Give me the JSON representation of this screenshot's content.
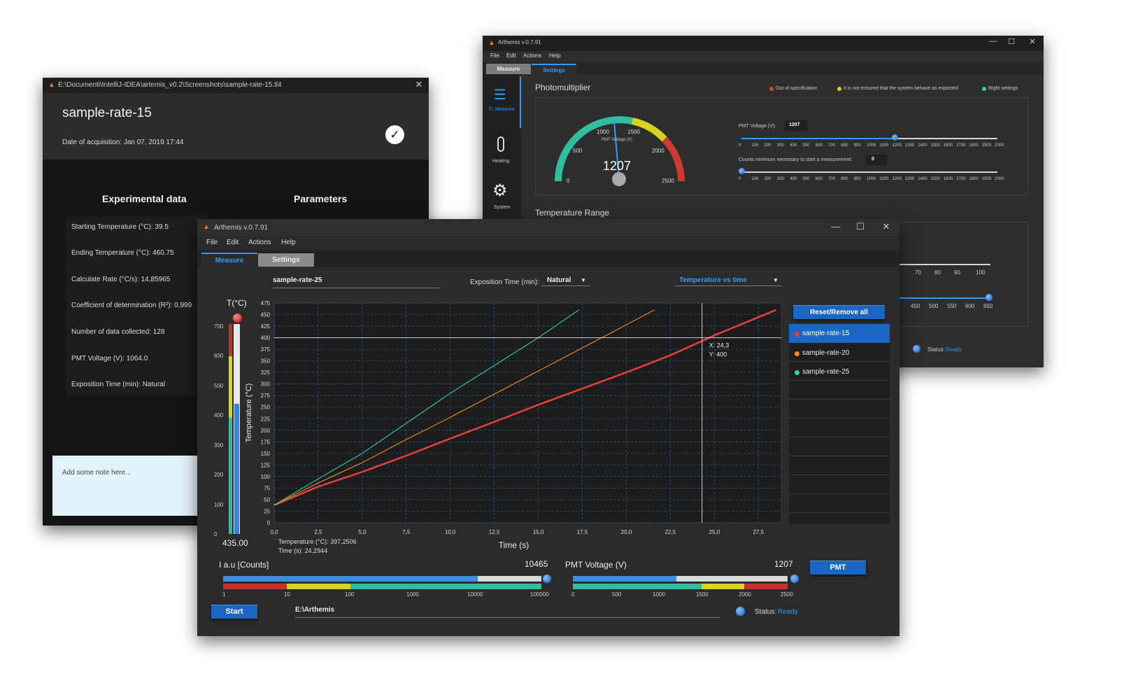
{
  "detail_window": {
    "path": "E:\\Documenti\\IntelliJ-IDEA\\artemis_v0.2\\Screenshots\\sample-rate-15.tl4",
    "sample_name": "sample-rate-15",
    "acquisition": "Date of acquisition:  Jan 07, 2019 17:44",
    "section_experimental": "Experimental data",
    "section_parameters": "Parameters",
    "rows": [
      "Starting Temperature (°C):  39.5",
      "Ending Temperature (°C):  460.75",
      "Calculate Rate (°C/s):   14,85965",
      "Coefficient of determination (R²):  0,999",
      "Number of  data collected:  128",
      "PMT Voltage (V):  1064.0",
      "Exposition Time (min):  Natural"
    ],
    "note_placeholder": "Add some note here..."
  },
  "settings_window": {
    "title": "Arthemis v.0.7.91",
    "menu": [
      "File",
      "Edit",
      "Actions",
      "Help"
    ],
    "tabs": [
      "Measure",
      "Settings"
    ],
    "side_nav": [
      "TL Measure",
      "Heating",
      "System"
    ],
    "photomultiplier_title": "Photomultiplier",
    "legend": [
      "Out of specification",
      "It is not ensured that the system behave as expected",
      "Right settings"
    ],
    "gauge": {
      "label": "PMT Voltage (V)",
      "value": "1207",
      "ticks": [
        "0",
        "500",
        "1000",
        "1500",
        "2000",
        "2500"
      ]
    },
    "pmt_voltage_label": "PMT Voltage (V):",
    "pmt_voltage_value": "1207",
    "counts_label": "Counts minimum necessary to start a measurement:",
    "counts_value": "0",
    "slider_ticks": [
      "0",
      "100",
      "200",
      "300",
      "400",
      "500",
      "600",
      "700",
      "800",
      "900",
      "1000",
      "1100",
      "1200",
      "1300",
      "1400",
      "1500",
      "1600",
      "1700",
      "1800",
      "1900",
      "2000"
    ],
    "temperature_range_title": "Temperature Range",
    "range_ticks_a": [
      "70",
      "80",
      "90",
      "100"
    ],
    "range_ticks_b": [
      "450",
      "500",
      "550",
      "600",
      "650"
    ],
    "status_label": "Status:",
    "status_value": "Ready"
  },
  "main_window": {
    "title": "Arthemis v.0.7.91",
    "menu": [
      "File",
      "Edit",
      "Actions",
      "Help"
    ],
    "tabs": [
      "Measure",
      "Settings"
    ],
    "sample_name": "sample-rate-25",
    "exposition_label": "Exposition Time (min):",
    "exposition_value": "Natural",
    "chart_select": "Temperature vs time",
    "thermo_title": "T(°C)",
    "thermo_value": "435.00",
    "thermo_ticks": [
      "700",
      "600",
      "500",
      "400",
      "300",
      "200",
      "100",
      "0"
    ],
    "thermo_level": 0.62,
    "cursor_readout": [
      "Temperature (°C): 397,2506",
      "Time (s): 24,2944"
    ],
    "crosshair_label": [
      "X: 24,3",
      "Y: 400"
    ],
    "reset_button": "Reset/Remove all",
    "samples": [
      {
        "name": "sample-rate-15",
        "color": "#e8403a"
      },
      {
        "name": "sample-rate-20",
        "color": "#f0901e"
      },
      {
        "name": "sample-rate-25",
        "color": "#2fd1a8"
      }
    ],
    "counts_label": "I a.u [Counts]",
    "counts_value": "10465",
    "counts_ticks": [
      "1",
      "10",
      "100",
      "1000",
      "10000",
      "100000"
    ],
    "pmt_label": "PMT Voltage (V)",
    "pmt_value": "1207",
    "pmt_ticks": [
      "0",
      "500",
      "1000",
      "1500",
      "2000",
      "2500"
    ],
    "pmt_button": "PMT",
    "start_button": "Start",
    "path": "E:\\Arthemis",
    "status_label": "Status:",
    "status_value": "Ready"
  },
  "chart_data": {
    "type": "line",
    "xlabel": "Time (s)",
    "ylabel": "Temperature (°C)",
    "xlim": [
      0,
      28.8
    ],
    "ylim": [
      0,
      475
    ],
    "xticks": [
      "0,0",
      "2,5",
      "5,0",
      "7,5",
      "10,0",
      "12,5",
      "15,0",
      "17,5",
      "20,0",
      "22,5",
      "25,0",
      "27,5"
    ],
    "yticks": [
      "0",
      "25",
      "50",
      "75",
      "100",
      "125",
      "150",
      "175",
      "200",
      "225",
      "250",
      "275",
      "300",
      "325",
      "350",
      "375",
      "400",
      "425",
      "450",
      "475"
    ],
    "crosshair": {
      "x": 24.3,
      "y": 400
    },
    "series": [
      {
        "name": "sample-rate-15",
        "color": "#e8403a",
        "x": [
          0,
          2.5,
          5,
          7.5,
          10,
          12.5,
          15,
          17.5,
          20,
          22.5,
          25,
          28.5
        ],
        "y": [
          38,
          78,
          110,
          145,
          182,
          218,
          255,
          290,
          325,
          362,
          405,
          460
        ]
      },
      {
        "name": "sample-rate-20",
        "color": "#f0901e",
        "x": [
          0,
          2.5,
          5,
          7.5,
          10,
          12.5,
          15,
          17.5,
          20,
          21.6
        ],
        "y": [
          38,
          86,
          130,
          180,
          228,
          278,
          328,
          378,
          428,
          460
        ]
      },
      {
        "name": "sample-rate-25",
        "color": "#2fd1a8",
        "x": [
          0,
          2.5,
          5,
          7.5,
          10,
          12.5,
          15,
          17.3
        ],
        "y": [
          38,
          95,
          150,
          215,
          280,
          340,
          400,
          460
        ]
      }
    ]
  }
}
